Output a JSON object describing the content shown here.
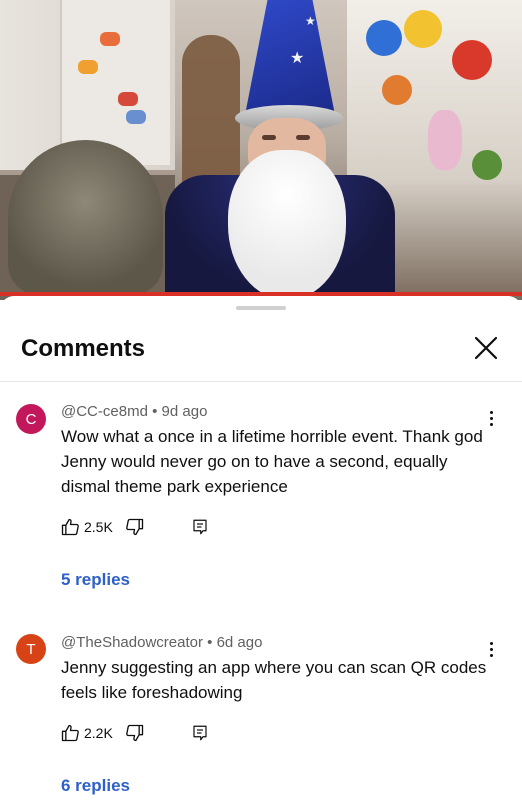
{
  "video": {
    "progress_fraction": 1.0,
    "accent_color": "#d93025"
  },
  "comments_panel": {
    "title": "Comments",
    "close_icon": "close-icon",
    "comments": [
      {
        "avatar_letter": "C",
        "avatar_color": "#c2185b",
        "author": "@CC-ce8md",
        "separator": "•",
        "age": "9d ago",
        "text": "Wow what a once in a lifetime horrible event. Thank god Jenny would never go on to have a second, equally dismal theme park experience",
        "likes": "2.5K",
        "replies": "5 replies"
      },
      {
        "avatar_letter": "T",
        "avatar_color": "#d84315",
        "author": "@TheShadowcreator",
        "separator": "•",
        "age": "6d ago",
        "text": "Jenny suggesting an app where you can scan QR codes feels like foreshadowing",
        "likes": "2.2K",
        "replies": "6 replies"
      }
    ]
  }
}
